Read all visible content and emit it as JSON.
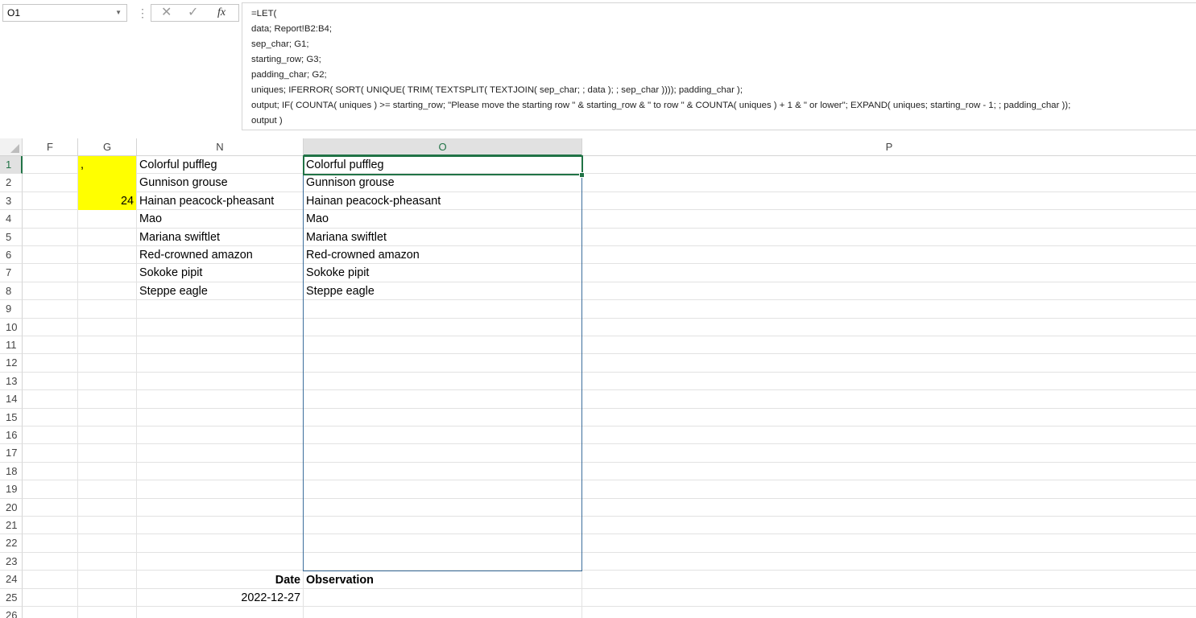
{
  "formula_bar": {
    "name_box": "O1",
    "cancel_icon": "close-icon",
    "enter_icon": "checkmark-icon",
    "fx_label": "fx",
    "formula": "=LET(\ndata; Report!B2:B4;\nsep_char; G1;\nstarting_row; G3;\npadding_char; G2;\nuniques; IFERROR( SORT( UNIQUE( TRIM( TEXTSPLIT( TEXTJOIN( sep_char; ; data ); ; sep_char )))); padding_char );\noutput; IF( COUNTA( uniques ) >= starting_row; \"Please move the starting row \" & starting_row & \" to row \" & COUNTA( uniques ) + 1 & \" or lower\"; EXPAND( uniques; starting_row - 1; ; padding_char ));\noutput )"
  },
  "sheet": {
    "columns": [
      "F",
      "G",
      "N",
      "O",
      "P"
    ],
    "active_column": "O",
    "active_row": "1",
    "rows": [
      "1",
      "2",
      "3",
      "4",
      "5",
      "6",
      "7",
      "8",
      "9",
      "10",
      "11",
      "12",
      "13",
      "14",
      "15",
      "16",
      "17",
      "18",
      "19",
      "20",
      "21",
      "22",
      "23",
      "24",
      "25",
      "26"
    ],
    "cells": {
      "G1": ",",
      "G3": "24",
      "N": [
        "Colorful puffleg",
        "Gunnison grouse",
        "Hainan peacock-pheasant",
        "Mao",
        "Mariana swiftlet",
        "Red-crowned amazon",
        "Sokoke pipit",
        "Steppe eagle"
      ],
      "O": [
        "Colorful puffleg",
        "Gunnison grouse",
        "Hainan peacock-pheasant",
        "Mao",
        "Mariana swiftlet",
        "Red-crowned amazon",
        "Sokoke pipit",
        "Steppe eagle"
      ],
      "N24": "Date",
      "O24": "Observation",
      "N25": "2022-12-27"
    },
    "colors": {
      "highlight": "#ffff00",
      "selection": "#217346",
      "spill_border": "#3c6e9c"
    }
  }
}
